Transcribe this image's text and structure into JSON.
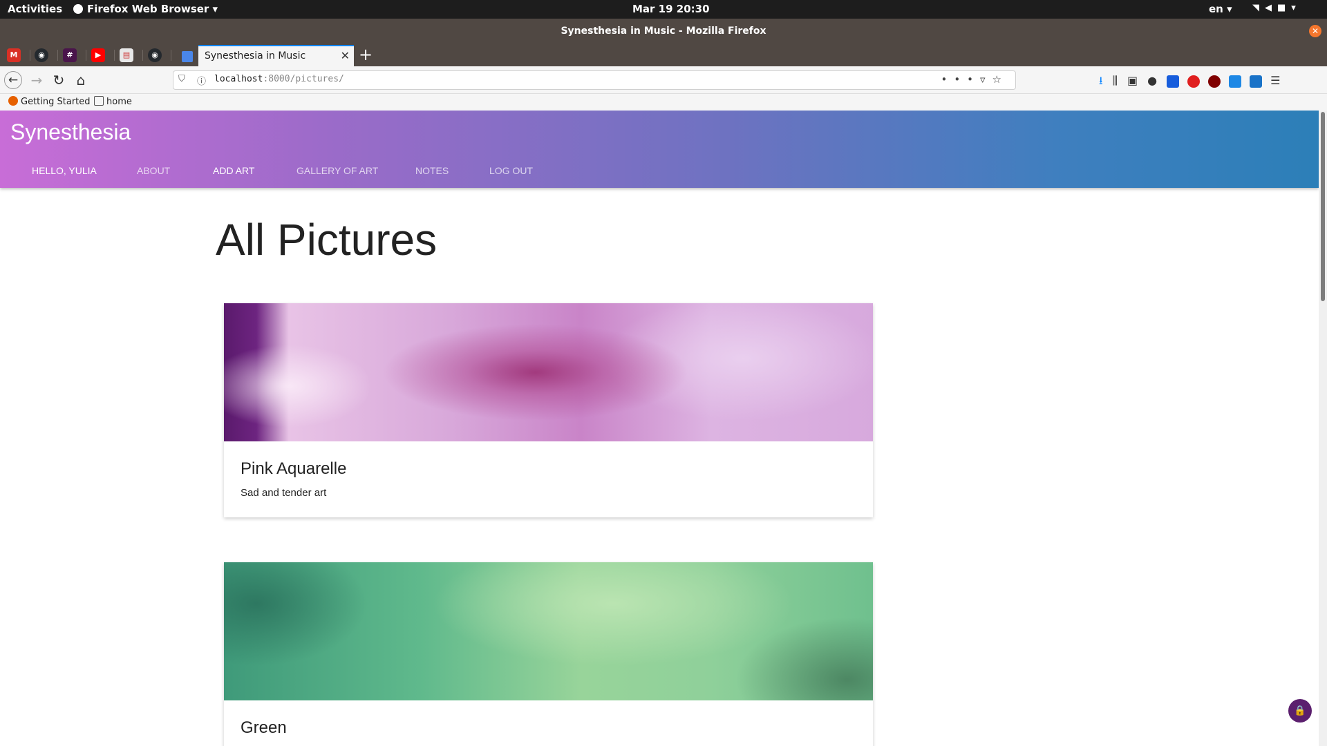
{
  "system": {
    "activities": "Activities",
    "app_menu": "Firefox Web Browser ▾",
    "clock": "Mar 19  20:30",
    "lang": "en ▾"
  },
  "window": {
    "title": "Synesthesia in Music - Mozilla Firefox"
  },
  "tabs": {
    "active_label": "Synesthesia in Music",
    "pinned": [
      "gmail-icon",
      "github-icon",
      "slack-icon",
      "youtube-icon",
      "notes-icon",
      "github-icon",
      "docs-icon"
    ]
  },
  "nav": {
    "url_host": "localhost",
    "url_path": ":8000/pictures/"
  },
  "bookmarks": [
    {
      "label": "Getting Started"
    },
    {
      "label": "home"
    }
  ],
  "site": {
    "brand": "Synesthesia",
    "menu": [
      "HELLO, YULIA",
      "ABOUT",
      "ADD ART",
      "GALLERY OF ART",
      "NOTES",
      "LOG OUT"
    ]
  },
  "page": {
    "title": "All Pictures",
    "cards": [
      {
        "title": "Pink Aquarelle",
        "description": "Sad and tender art"
      },
      {
        "title": "Green",
        "description": ""
      }
    ]
  },
  "colors": {
    "hero_start": "#c86dd7",
    "hero_end": "#2c7fb8",
    "fab": "#5b1f6e",
    "tab_accent": "#0a84ff"
  }
}
